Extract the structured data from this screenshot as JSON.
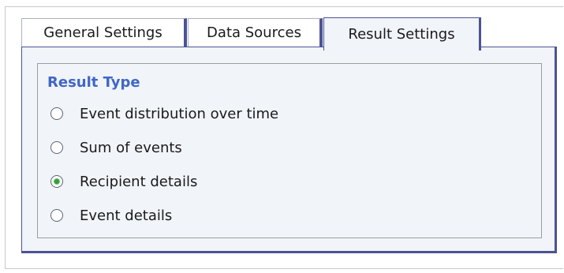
{
  "tabs": [
    {
      "label": "General Settings",
      "active": false
    },
    {
      "label": "Data Sources",
      "active": false
    },
    {
      "label": "Result Settings",
      "active": true
    }
  ],
  "result_type": {
    "title": "Result Type",
    "options": [
      {
        "label": "Event distribution over time",
        "selected": false
      },
      {
        "label": "Sum of events",
        "selected": false
      },
      {
        "label": "Recipient details",
        "selected": true
      },
      {
        "label": "Event details",
        "selected": false
      }
    ]
  },
  "colors": {
    "accent_border": "#4b5395",
    "title_blue": "#3f67c7",
    "panel_bg": "#f1f4f8",
    "selected_dot": "#33a033"
  }
}
